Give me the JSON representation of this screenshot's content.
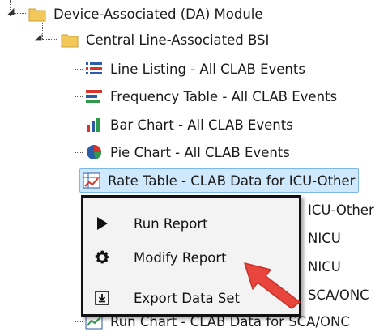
{
  "tree": {
    "root": {
      "label": "Device-Associated (DA) Module",
      "icon": "folder-icon"
    },
    "child": {
      "label": "Central Line-Associated BSI",
      "icon": "folder-icon"
    },
    "items": [
      {
        "label": "Line Listing - All CLAB Events",
        "icon": "line-listing-icon"
      },
      {
        "label": "Frequency Table - All CLAB Events",
        "icon": "frequency-table-icon"
      },
      {
        "label": "Bar Chart - All CLAB Events",
        "icon": "bar-chart-icon"
      },
      {
        "label": "Pie Chart - All CLAB Events",
        "icon": "pie-chart-icon"
      },
      {
        "label": "Rate Table - CLAB Data for ICU-Other",
        "icon": "rate-table-icon",
        "selected": true
      },
      {
        "label": "ICU-Other",
        "icon": "rate-table-icon",
        "partial": true
      },
      {
        "label": "NICU",
        "icon": "rate-table-icon",
        "partial": true
      },
      {
        "label": "NICU",
        "icon": "rate-table-icon",
        "partial": true
      },
      {
        "label": "SCA/ONC",
        "icon": "rate-table-icon",
        "partial": true
      },
      {
        "label": "Run Chart - CLAB Data for SCA/ONC",
        "icon": "run-chart-icon"
      }
    ]
  },
  "context_menu": {
    "items": [
      {
        "label": "Run Report",
        "icon": "play-icon"
      },
      {
        "label": "Modify Report",
        "icon": "gear-icon"
      },
      {
        "label": "Export Data Set",
        "icon": "export-icon"
      }
    ]
  },
  "colors": {
    "folder": "#f2c85b",
    "selection_bg": "#cfe8fb",
    "arrow": "#e8453c"
  }
}
